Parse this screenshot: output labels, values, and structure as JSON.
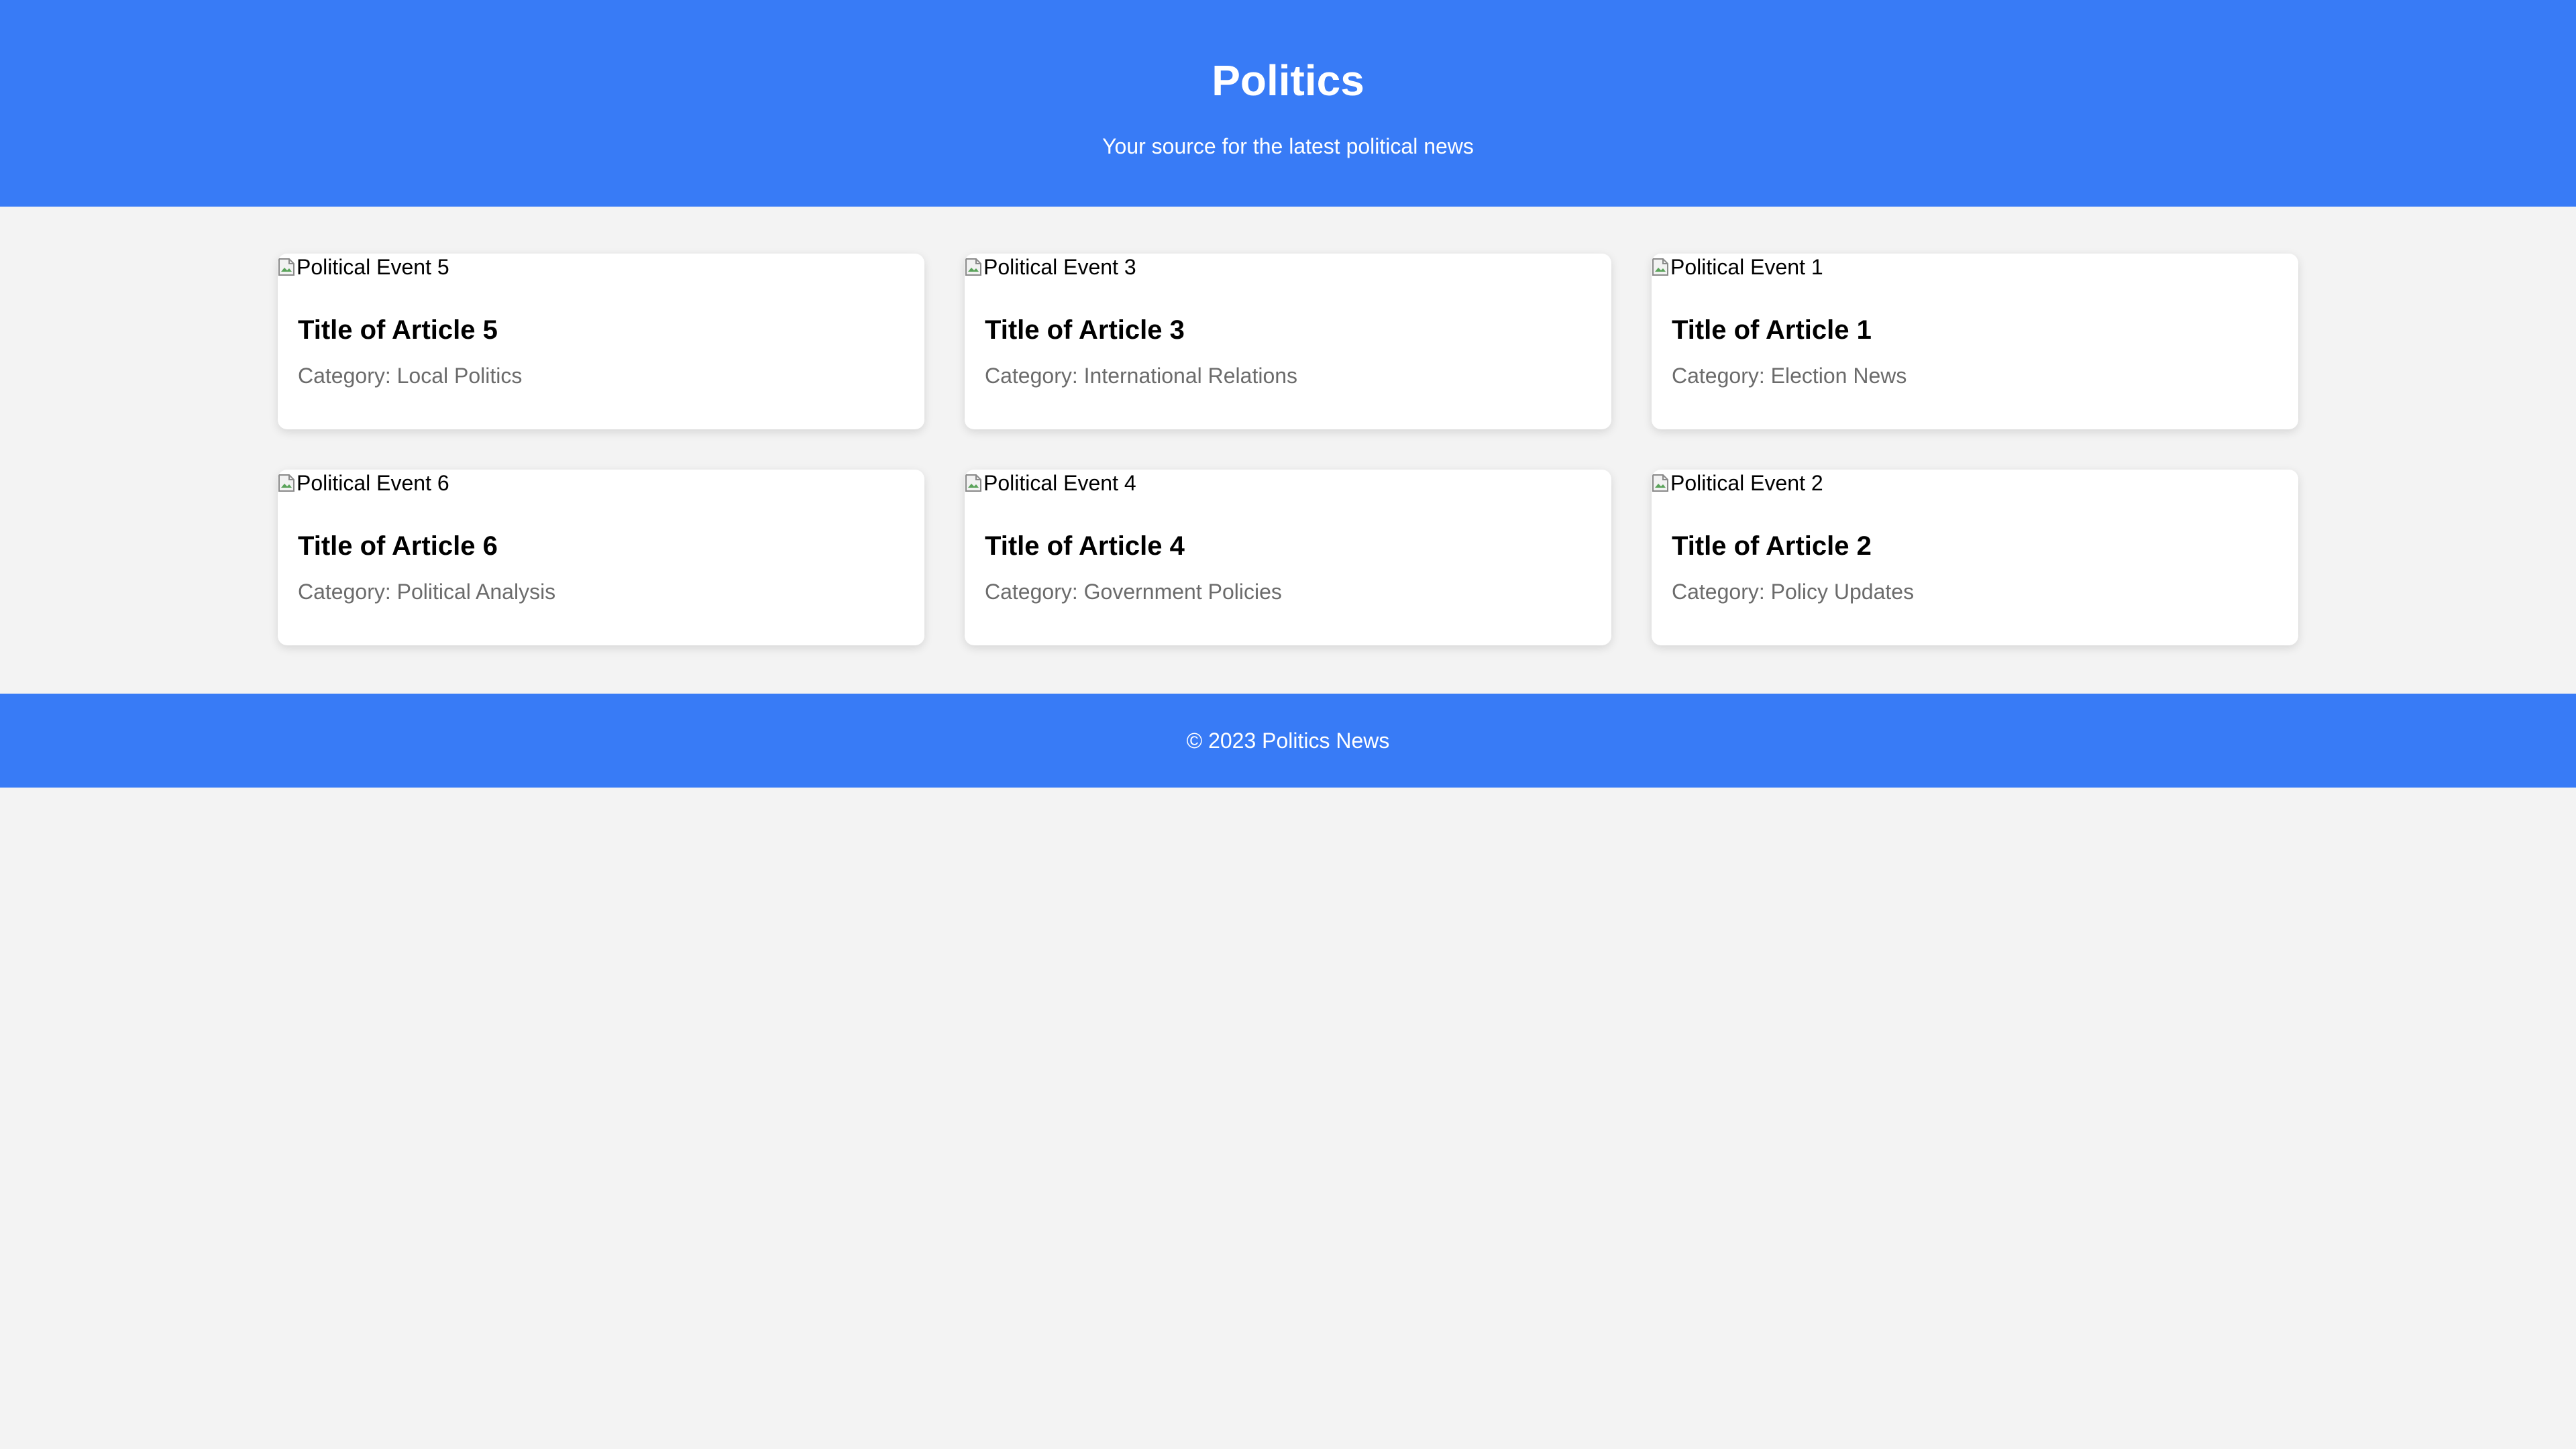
{
  "header": {
    "title": "Politics",
    "subtitle": "Your source for the latest political news"
  },
  "articles": [
    {
      "image_alt": "Political Event 5",
      "title": "Title of Article 5",
      "category": "Category: Local Politics"
    },
    {
      "image_alt": "Political Event 3",
      "title": "Title of Article 3",
      "category": "Category: International Relations"
    },
    {
      "image_alt": "Political Event 1",
      "title": "Title of Article 1",
      "category": "Category: Election News"
    },
    {
      "image_alt": "Political Event 6",
      "title": "Title of Article 6",
      "category": "Category: Political Analysis"
    },
    {
      "image_alt": "Political Event 4",
      "title": "Title of Article 4",
      "category": "Category: Government Policies"
    },
    {
      "image_alt": "Political Event 2",
      "title": "Title of Article 2",
      "category": "Category: Policy Updates"
    }
  ],
  "footer": {
    "text": "© 2023 Politics News"
  },
  "colors": {
    "brand": "#387bf6",
    "background": "#f3f3f3",
    "card": "#ffffff",
    "muted_text": "#6b6b6b"
  },
  "icons": {
    "broken_image": "broken-image-icon"
  }
}
